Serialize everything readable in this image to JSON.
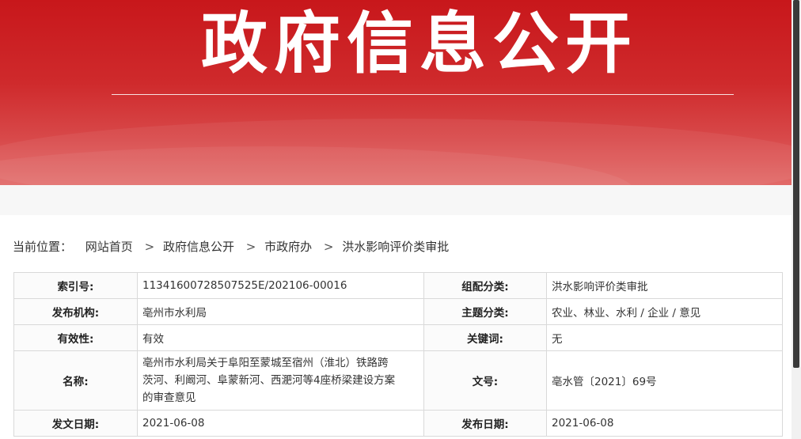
{
  "banner": {
    "title": "政府信息公开"
  },
  "breadcrumb": {
    "label": "当前位置：",
    "items": [
      "网站首页",
      "政府信息公开",
      "市政府办",
      "洪水影响评价类审批"
    ],
    "separator": ">"
  },
  "meta": {
    "index_no_label": "索引号:",
    "index_no": "11341600728507525E/202106-00016",
    "category_label": "组配分类:",
    "category": "洪水影响评价类审批",
    "publisher_label": "发布机构:",
    "publisher": "亳州市水利局",
    "topic_label": "主题分类:",
    "topic": "农业、林业、水利 / 企业 / 意见",
    "validity_label": "有效性:",
    "validity": "有效",
    "keywords_label": "关键词:",
    "keywords": "无",
    "name_label": "名称:",
    "name_line1": "亳州市水利局关于阜阳至蒙城至宿州（淮北）铁路跨",
    "name_line2": "茨河、利阚河、阜蒙新河、西淝河等4座桥梁建设方案",
    "name_line3": "的审查意见",
    "doc_no_label": "文号:",
    "doc_no": "亳水管〔2021〕69号",
    "doc_date_label": "发文日期:",
    "doc_date": "2021-06-08",
    "pub_date_label": "发布日期:",
    "pub_date": "2021-06-08"
  },
  "colors": {
    "banner_red": "#c8171b",
    "text": "#333333",
    "border": "#d9d9d9"
  }
}
